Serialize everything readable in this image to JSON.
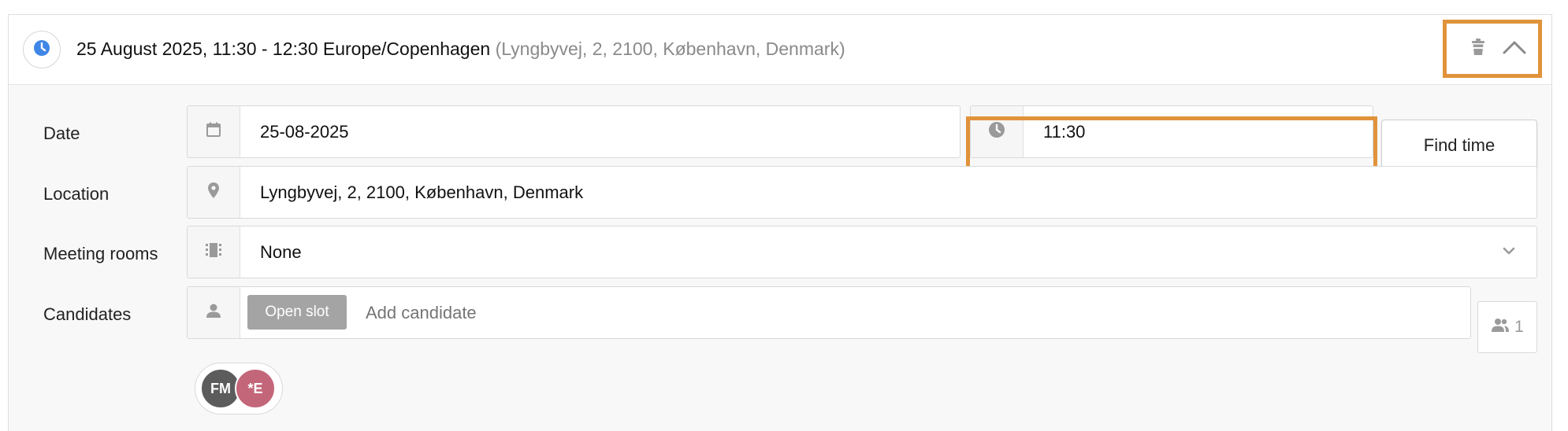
{
  "colors": {
    "accent": "#e0933a",
    "status_blue": "#3f86e6",
    "avatar_fm": "#5c5c5c",
    "avatar_e": "#c4667a",
    "open_slot_bg": "#a4a4a4"
  },
  "header": {
    "title": "25 August 2025, 11:30 - 12:30 Europe/Copenhagen",
    "subtitle": "(Lyngbyvej, 2, 2100, København, Denmark)",
    "status_icon": "clock-icon",
    "actions": [
      {
        "icon": "trash-icon"
      },
      {
        "icon": "chevron-up-icon"
      }
    ]
  },
  "form": {
    "date": {
      "label": "Date",
      "icon": "calendar-icon",
      "value": "25-08-2025"
    },
    "time": {
      "icon": "clock-icon",
      "value": "11:30"
    },
    "find_time_label": "Find time",
    "location": {
      "label": "Location",
      "icon": "location-pin-icon",
      "value": "Lyngbyvej, 2, 2100, København, Denmark"
    },
    "meeting_rooms": {
      "label": "Meeting rooms",
      "icon": "door-icon",
      "selected": "None",
      "dropdown_icon": "chevron-down-icon"
    },
    "candidates": {
      "label": "Candidates",
      "icon": "person-icon",
      "open_slot_label": "Open slot",
      "placeholder": "Add candidate",
      "count_icon": "people-icon",
      "count": "1",
      "avatars": [
        {
          "initials": "FM"
        },
        {
          "initials": "*E"
        }
      ]
    }
  }
}
